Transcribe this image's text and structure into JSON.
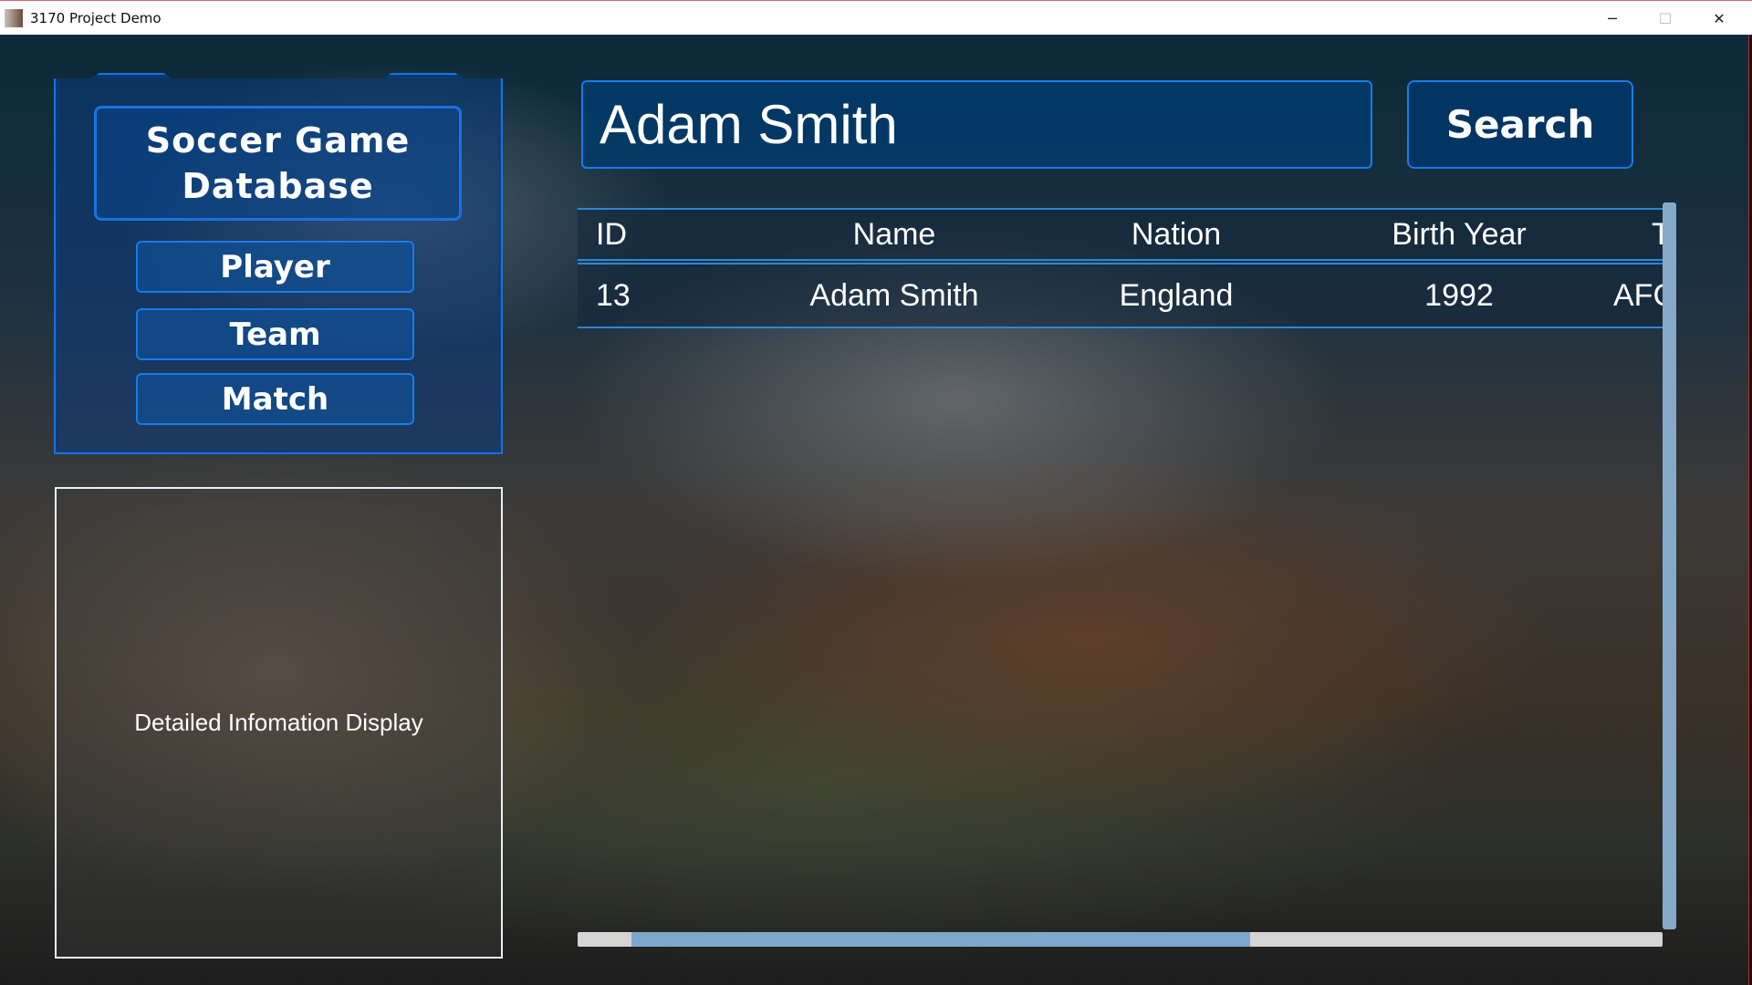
{
  "window": {
    "title": "3170 Project Demo",
    "minimize": "─",
    "maximize": "☐",
    "close": "✕"
  },
  "nav": {
    "title_line1": "Soccer Game",
    "title_line2": "Database",
    "items": [
      {
        "label": "Player"
      },
      {
        "label": "Team"
      },
      {
        "label": "Match"
      }
    ]
  },
  "detail": {
    "label": "Detailed Infomation Display"
  },
  "search": {
    "value": "Adam Smith",
    "button": "Search"
  },
  "table": {
    "headers": [
      "ID",
      "Name",
      "Nation",
      "Birth Year",
      "T"
    ],
    "rows": [
      [
        "13",
        "Adam Smith",
        "England",
        "1992",
        "AFC"
      ]
    ]
  },
  "scroll": {
    "horizontal_thumb_start": 0.05,
    "horizontal_thumb_end": 0.62
  }
}
